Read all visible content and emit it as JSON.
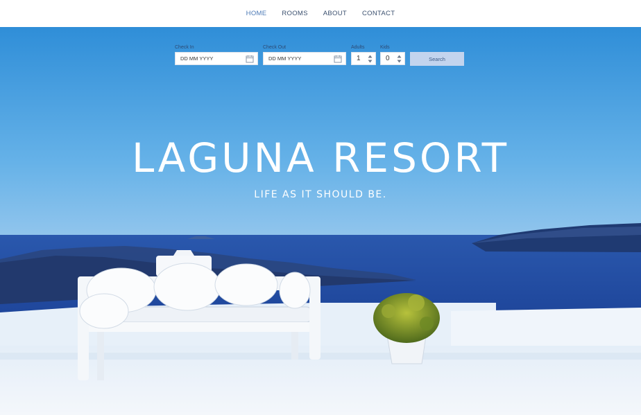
{
  "nav": {
    "items": [
      {
        "label": "HOME",
        "active": true
      },
      {
        "label": "ROOMS"
      },
      {
        "label": "ABOUT"
      },
      {
        "label": "CONTACT"
      }
    ]
  },
  "booking": {
    "check_in_label": "Check In",
    "check_in_placeholder": "DD MM YYYY",
    "check_out_label": "Check Out",
    "check_out_placeholder": "DD MM YYYY",
    "adults_label": "Adults",
    "adults_value": "1",
    "kids_label": "Kids",
    "kids_value": "0",
    "search_label": "Search"
  },
  "hero": {
    "title": "LAGUNA RESORT",
    "subtitle": "LIFE AS IT SHOULD BE."
  },
  "colors": {
    "accent": "#4a78b5",
    "search_button": "#c3d4ee",
    "sky_top": "#2f8fd8",
    "sea": "#1d4aa0"
  }
}
